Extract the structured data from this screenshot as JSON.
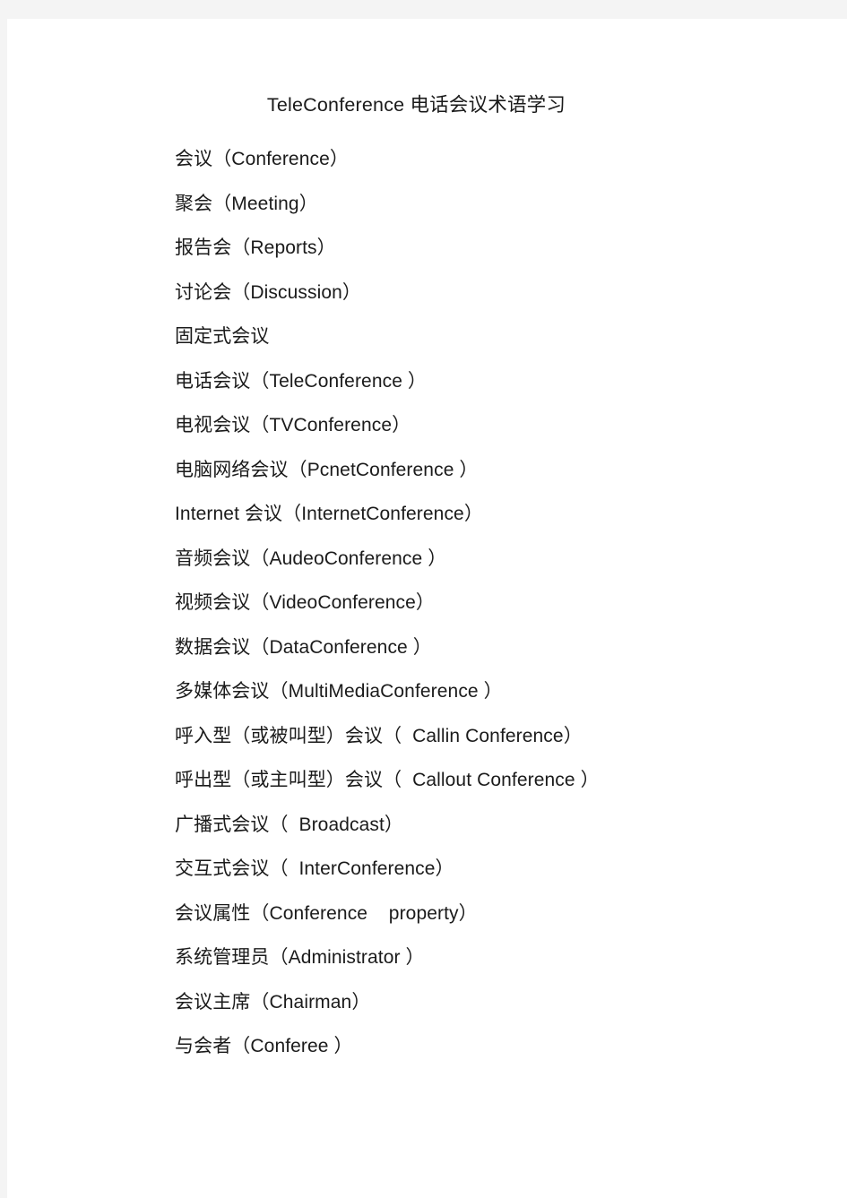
{
  "document": {
    "title": "TeleConference 电话会议术语学习",
    "page_background": "#ffffff",
    "gutter_color": "#f4f4f4",
    "text_color": "#1b1b1b",
    "terms": [
      {
        "text": "会议（Conference）"
      },
      {
        "text": "聚会（Meeting）"
      },
      {
        "text": "报告会（Reports）"
      },
      {
        "text": "讨论会（Discussion）"
      },
      {
        "text": "固定式会议"
      },
      {
        "text": "电话会议（TeleConference ）"
      },
      {
        "text": "电视会议（TVConference）"
      },
      {
        "text": "电脑网络会议（PcnetConference ）"
      },
      {
        "text": "Internet 会议（InternetConference）"
      },
      {
        "text": "音频会议（AudeoConference ）"
      },
      {
        "text": "视频会议（VideoConference）"
      },
      {
        "text": "数据会议（DataConference ）"
      },
      {
        "text": "多媒体会议（MultiMediaConference ）"
      },
      {
        "text": "呼入型（或被叫型）会议（  Callin Conference）"
      },
      {
        "text": "呼出型（或主叫型）会议（  Callout Conference ）"
      },
      {
        "text": "广播式会议（  Broadcast）"
      },
      {
        "text": "交互式会议（  InterConference）"
      },
      {
        "text": "会议属性（Conference    property）"
      },
      {
        "text": "系统管理员（Administrator ）"
      },
      {
        "text": "会议主席（Chairman）"
      },
      {
        "text": "与会者（Conferee ）"
      }
    ]
  }
}
